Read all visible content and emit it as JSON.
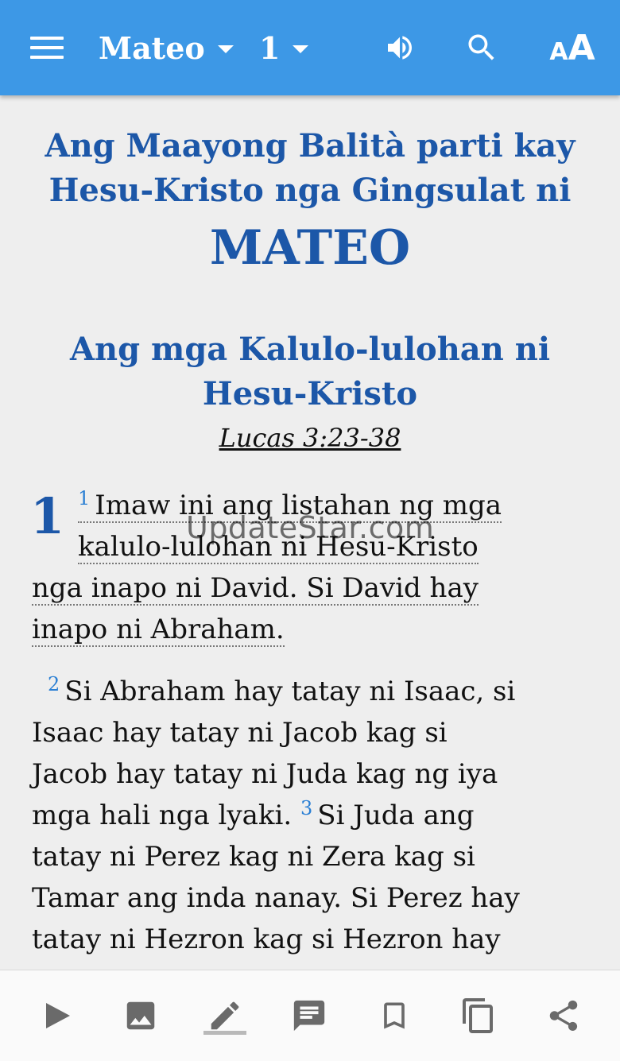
{
  "app_bar": {
    "menu_icon": "hamburger-menu-icon",
    "book": "Mateo",
    "chapter": "1",
    "audio_icon": "speaker-icon",
    "search_icon": "search-icon",
    "text_size_icon": "text-size-icon",
    "text_size_small": "A",
    "text_size_big": "A",
    "background_color": "#3d98e6"
  },
  "content": {
    "book_title_line1": "Ang Maayong Balità parti kay",
    "book_title_line2": "Hesu-Kristo nga Gingsulat ni",
    "book_name": "MATEO",
    "section_title_line1": "Ang mga Kalulo-lulohan ni",
    "section_title_line2": "Hesu-Kristo",
    "parallel_reference": "Lucas 3:23-38",
    "chapter_number": "1",
    "verses": {
      "v1_num": "1",
      "v1_line1": "Imaw ini ang listahan ng mga",
      "v1_line2": "kalulo-lulohan ni Hesu-Kristo",
      "v1_line3": "nga inapo ni David. Si David hay",
      "v1_line4": "inapo ni Abraham.",
      "v2_num": "2",
      "v2_line1": "Si Abraham hay tatay ni Isaac, si",
      "v2_line2": "Isaac hay tatay ni Jacob kag si",
      "v2_line3": "Jacob hay tatay ni Juda kag ng iya",
      "v2_line4a": "mga hali nga lyaki.",
      "v3_num": "3",
      "v3_line4b": "Si Juda ang",
      "v3_line5": "tatay ni Perez kag ni Zera kag si",
      "v3_line6": "Tamar ang inda nanay. Si Perez hay",
      "v3_line7": "tatay ni Hezron kag si Hezron hay"
    },
    "title_color": "#1c57a8",
    "verse_number_color": "#2a7fd4"
  },
  "watermark": "UpdateStar.com",
  "bottom_bar": {
    "icons": [
      "play-icon",
      "image-icon",
      "pencil-icon",
      "comment-icon",
      "bookmark-icon",
      "copy-icon",
      "share-icon"
    ]
  }
}
